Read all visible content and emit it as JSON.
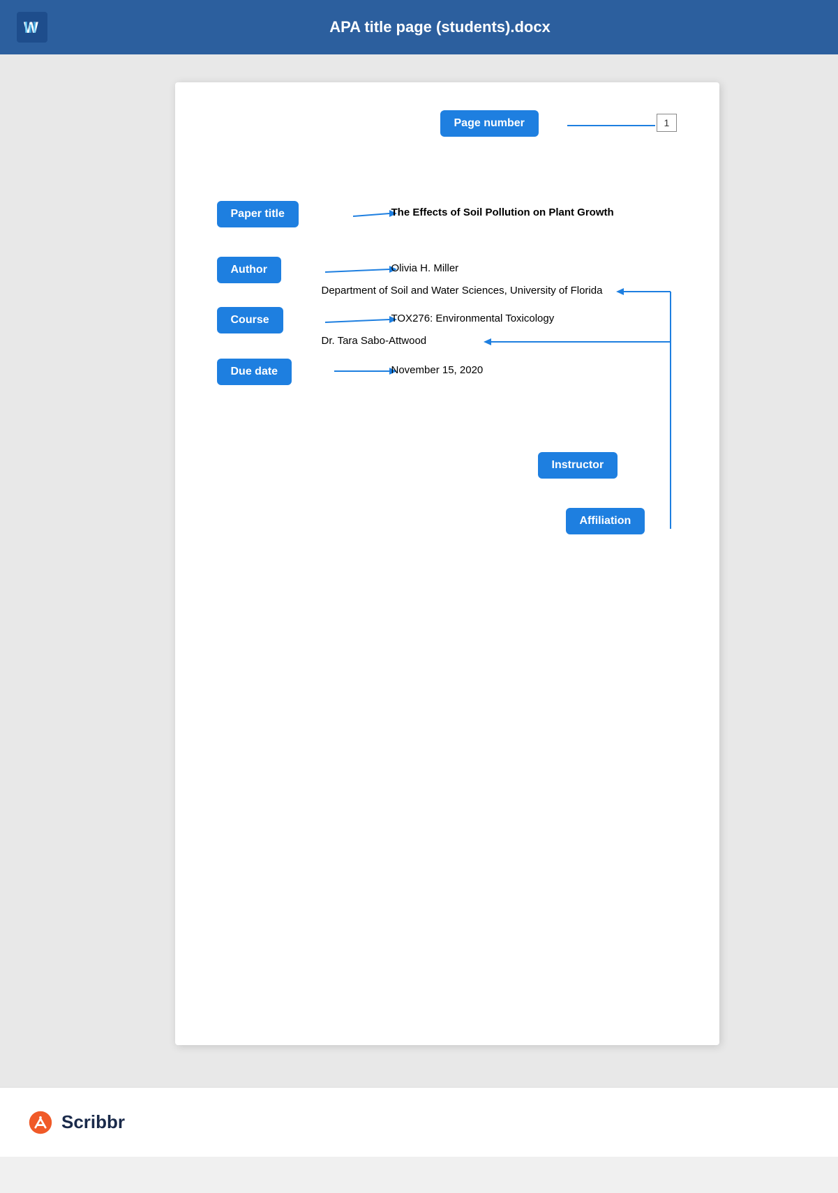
{
  "header": {
    "title": "APA title page (students).docx",
    "word_icon": "W"
  },
  "labels": {
    "page_number": "Page number",
    "paper_title": "Paper title",
    "author": "Author",
    "course": "Course",
    "due_date": "Due date",
    "instructor": "Instructor",
    "affiliation": "Affiliation"
  },
  "document": {
    "page_number_value": "1",
    "paper_title_text": "The Effects of Soil Pollution on Plant Growth",
    "author_name": "Olivia H. Miller",
    "affiliation_text": "Department of Soil and Water Sciences, University of Florida",
    "course_text": "TOX276: Environmental Toxicology",
    "instructor_text": "Dr. Tara Sabo-Attwood",
    "due_date_text": "November 15, 2020"
  },
  "footer": {
    "brand_name": "Scribbr"
  },
  "colors": {
    "header_bg": "#2c5f9e",
    "label_btn_bg": "#1e7fe0",
    "accent": "#1e7fe0"
  }
}
